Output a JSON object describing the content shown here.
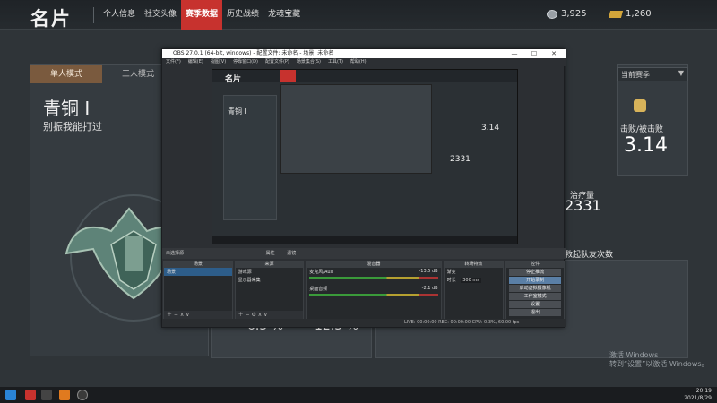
{
  "topbar": {
    "title": "名片",
    "nav": [
      "个人信息",
      "社交头像",
      "赛季数据",
      "历史战绩",
      "龙魂宝藏"
    ],
    "active_nav_index": 2,
    "silver": "3,925",
    "gold": "1,260"
  },
  "left": {
    "mode_tabs": [
      "单人模式",
      "三人模式"
    ],
    "rank": "青铜 I",
    "rank_sub": "别振我能打过"
  },
  "right": {
    "season": "当前赛季",
    "kd_label": "击败/被击败",
    "kd_value": "3.14",
    "heal_label": "治疗量",
    "heal_value": "2331",
    "revive_label": "救起队友次数"
  },
  "bottom": {
    "pct1": "6.5 %",
    "pct2": "12.5 %"
  },
  "obs": {
    "title": "OBS 27.0.1 (64-bit, windows) - 配置文件: 未命名 - 场景: 未命名",
    "menu": [
      "文件(F)",
      "编辑(E)",
      "视图(V)",
      "停靠窗口(D)",
      "配置文件(P)",
      "场景集合(S)",
      "工具(T)",
      "帮助(H)"
    ],
    "source_label": "未选择源",
    "properties_label": "属性",
    "filters_label": "滤镜",
    "docks": {
      "scenes": {
        "header": "场景",
        "items": [
          "场景"
        ]
      },
      "sources": {
        "header": "来源",
        "items": [
          "游戏源",
          "显示器采集"
        ]
      },
      "mixer": {
        "header": "混音器",
        "channels": [
          {
            "name": "麦克风/Aux",
            "db": "-13.5 dB"
          },
          {
            "name": "桌面音频",
            "db": "-2.1 dB"
          }
        ]
      },
      "transitions": {
        "header": "转场特效",
        "type": "渐变",
        "duration_label": "时长",
        "duration": "300 ms"
      },
      "controls": {
        "header": "控件",
        "buttons": [
          "停止推流",
          "开始录制",
          "启动虚拟摄像机",
          "工作室模式",
          "设置",
          "退出"
        ]
      }
    },
    "status": "LIVE: 00:00:00   REC: 00:00:00   CPU: 0.3%, 60.00 fps"
  },
  "watermark": {
    "line1": "激活 Windows",
    "line2": "转到“设置”以激活 Windows。"
  },
  "taskbar": {
    "time": "20:19",
    "date": "2021/8/29"
  },
  "colors": {
    "accent": "#c7322e",
    "mode_active": "#7a5a3e",
    "gold": "#d3a53a"
  }
}
